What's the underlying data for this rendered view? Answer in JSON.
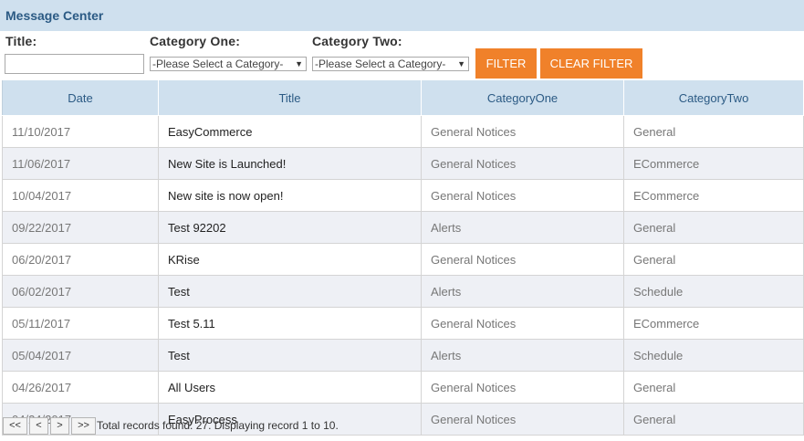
{
  "header": {
    "title": "Message Center"
  },
  "filters": {
    "title_label": "Title:",
    "title_value": "",
    "category_one_label": "Category One:",
    "category_one_value": "-Please Select a Category-",
    "category_two_label": "Category Two:",
    "category_two_value": "-Please Select a Category-",
    "filter_button": "FILTER",
    "clear_button": "CLEAR FILTER"
  },
  "table": {
    "columns": [
      "Date",
      "Title",
      "CategoryOne",
      "CategoryTwo"
    ],
    "rows": [
      {
        "date": "11/10/2017",
        "title": "EasyCommerce",
        "cat1": "General Notices",
        "cat2": "General"
      },
      {
        "date": "11/06/2017",
        "title": "New Site is Launched!",
        "cat1": "General Notices",
        "cat2": "ECommerce"
      },
      {
        "date": "10/04/2017",
        "title": "New site is now open!",
        "cat1": "General Notices",
        "cat2": "ECommerce"
      },
      {
        "date": "09/22/2017",
        "title": "Test 92202",
        "cat1": "Alerts",
        "cat2": "General"
      },
      {
        "date": "06/20/2017",
        "title": "KRise",
        "cat1": "General Notices",
        "cat2": "General"
      },
      {
        "date": "06/02/2017",
        "title": "Test",
        "cat1": "Alerts",
        "cat2": "Schedule"
      },
      {
        "date": "05/11/2017",
        "title": "Test 5.11",
        "cat1": "General Notices",
        "cat2": "ECommerce"
      },
      {
        "date": "05/04/2017",
        "title": "Test",
        "cat1": "Alerts",
        "cat2": "Schedule"
      },
      {
        "date": "04/26/2017",
        "title": "All Users",
        "cat1": "General Notices",
        "cat2": "General"
      },
      {
        "date": "04/24/2017",
        "title": "EasyProcess",
        "cat1": "General Notices",
        "cat2": "General"
      }
    ]
  },
  "pager": {
    "first": "<<",
    "prev": "<",
    "next": ">",
    "last": ">>",
    "status": "Total records found: 27. Displaying record 1 to 10."
  },
  "colors": {
    "header_bg": "#cfe0ee",
    "header_text": "#2b5a84",
    "accent": "#f0812a",
    "row_alt": "#eef0f5"
  }
}
